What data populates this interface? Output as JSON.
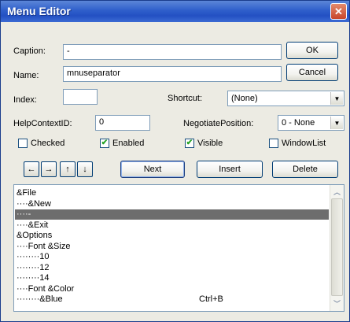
{
  "window": {
    "title": "Menu Editor",
    "close_glyph": "✕"
  },
  "caption": {
    "label": "Caption:",
    "value": "-"
  },
  "name": {
    "label": "Name:",
    "value": "mnuseparator"
  },
  "index": {
    "label": "Index:",
    "value": ""
  },
  "shortcut": {
    "label": "Shortcut:",
    "value": "(None)"
  },
  "helpcontext": {
    "label": "HelpContextID:",
    "value": "0"
  },
  "negotiate": {
    "label": "NegotiatePosition:",
    "value": "0 - None"
  },
  "buttons": {
    "ok": "OK",
    "cancel": "Cancel",
    "next": "Next",
    "insert": "Insert",
    "delete": "Delete"
  },
  "checkboxes": {
    "checked": {
      "label": "Checked",
      "value": false
    },
    "enabled": {
      "label": "Enabled",
      "value": true
    },
    "visible": {
      "label": "Visible",
      "value": true
    },
    "windowlist": {
      "label": "WindowList",
      "value": false
    }
  },
  "arrows": {
    "left": "←",
    "right": "→",
    "up": "↑",
    "down": "↓"
  },
  "menu_list": [
    {
      "text": "&File",
      "shortcut": "",
      "selected": false
    },
    {
      "text": "····&New",
      "shortcut": "",
      "selected": false
    },
    {
      "text": "····-",
      "shortcut": "",
      "selected": true
    },
    {
      "text": "····&Exit",
      "shortcut": "",
      "selected": false
    },
    {
      "text": "&Options",
      "shortcut": "",
      "selected": false
    },
    {
      "text": "····Font &Size",
      "shortcut": "",
      "selected": false
    },
    {
      "text": "········10",
      "shortcut": "",
      "selected": false
    },
    {
      "text": "········12",
      "shortcut": "",
      "selected": false
    },
    {
      "text": "········14",
      "shortcut": "",
      "selected": false
    },
    {
      "text": "····Font &Color",
      "shortcut": "",
      "selected": false
    },
    {
      "text": "········&Blue",
      "shortcut": "Ctrl+B",
      "selected": false
    }
  ],
  "colors": {
    "title_bar": "#2f5fcb",
    "selection": "#6d6d6d",
    "dialog_bg": "#ecebe3"
  }
}
